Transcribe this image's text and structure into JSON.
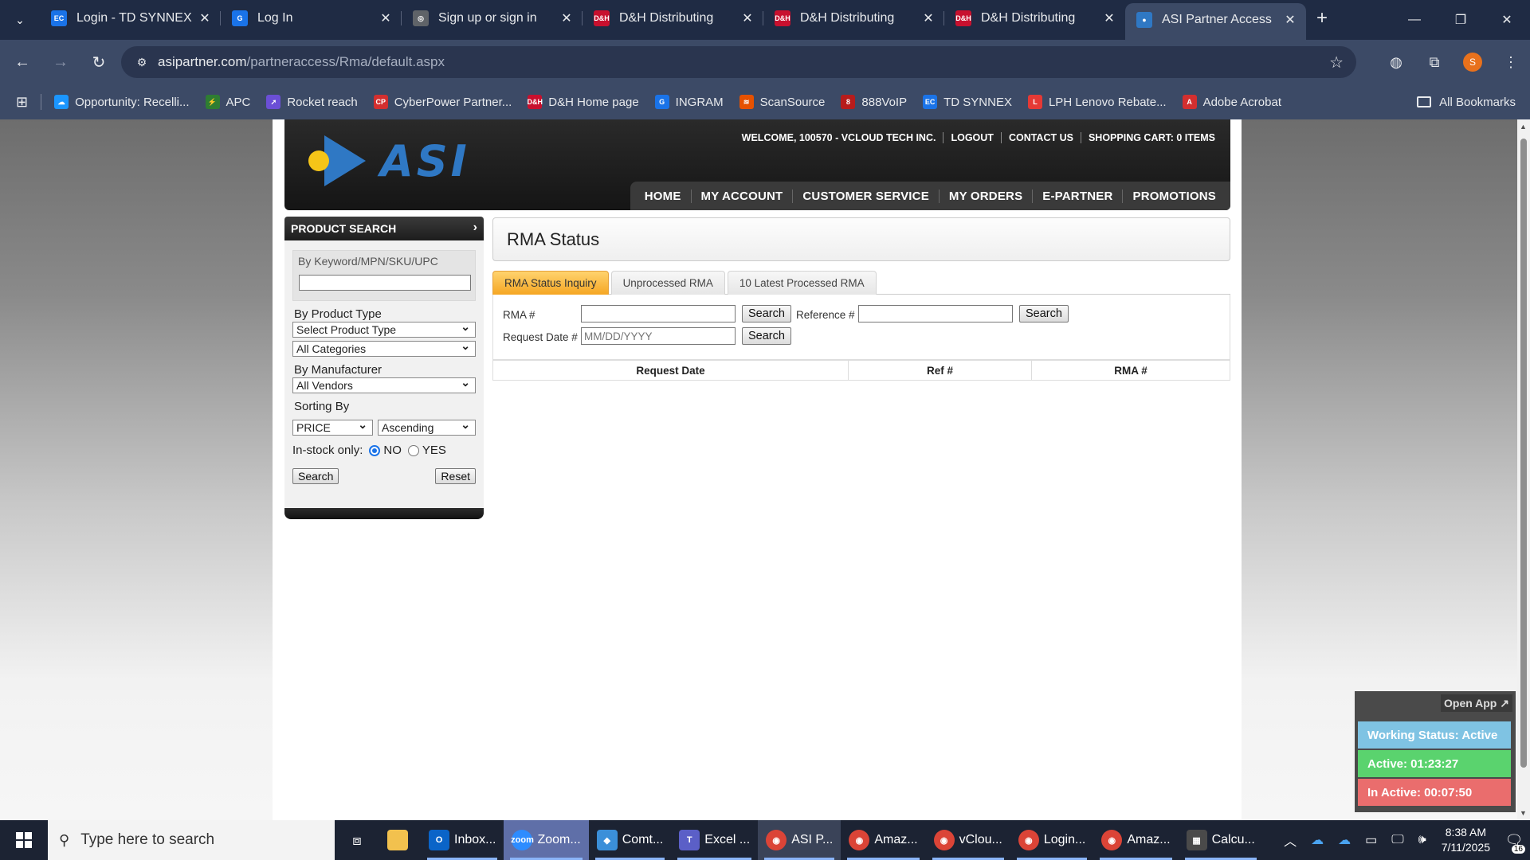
{
  "browser": {
    "tabs": [
      {
        "title": "Login - TD SYNNEX",
        "icon": "ec-icon",
        "color": "#1a73e8",
        "glyph": "EC"
      },
      {
        "title": "Log In",
        "icon": "g-logo-icon",
        "color": "#1a73e8",
        "glyph": "G"
      },
      {
        "title": "Sign up or sign in",
        "icon": "globe-icon",
        "color": "#5f6368",
        "glyph": "◎"
      },
      {
        "title": "D&H Distributing",
        "icon": "dh-icon",
        "color": "#c8102e",
        "glyph": "D&H"
      },
      {
        "title": "D&H Distributing",
        "icon": "dh-icon",
        "color": "#c8102e",
        "glyph": "D&H"
      },
      {
        "title": "D&H Distributing",
        "icon": "dh-icon",
        "color": "#c8102e",
        "glyph": "D&H"
      },
      {
        "title": "ASI Partner Access",
        "icon": "asi-icon",
        "color": "#2f78c4",
        "glyph": "●"
      }
    ],
    "active_tab": 6,
    "url_domain": "asipartner.com",
    "url_path": "/partneraccess/Rma/default.aspx",
    "profile_initial": "S",
    "bookmarks": [
      {
        "label": "Opportunity: Recelli...",
        "color": "#1b96ff",
        "glyph": "☁"
      },
      {
        "label": "APC",
        "color": "#2e7d32",
        "glyph": "⚡"
      },
      {
        "label": "Rocket reach",
        "color": "#6b4fd6",
        "glyph": "➚"
      },
      {
        "label": "CyberPower Partner...",
        "color": "#d32f2f",
        "glyph": "CP"
      },
      {
        "label": "D&H Home page",
        "color": "#c8102e",
        "glyph": "D&H"
      },
      {
        "label": "INGRAM",
        "color": "#1a73e8",
        "glyph": "G"
      },
      {
        "label": "ScanSource",
        "color": "#e65100",
        "glyph": "≋"
      },
      {
        "label": "888VoIP",
        "color": "#b71c1c",
        "glyph": "8"
      },
      {
        "label": "TD SYNNEX",
        "color": "#1a73e8",
        "glyph": "EC"
      },
      {
        "label": "LPH Lenovo Rebate...",
        "color": "#e53935",
        "glyph": "L"
      },
      {
        "label": "Adobe Acrobat",
        "color": "#d32f2f",
        "glyph": "A"
      }
    ],
    "all_bookmarks": "All Bookmarks"
  },
  "site": {
    "logo_text": "ASI",
    "top_links": [
      "WELCOME, 100570 - VCLOUD TECH INC.",
      "LOGOUT",
      "CONTACT US",
      "SHOPPING CART: 0 ITEMS"
    ],
    "nav": [
      "HOME",
      "MY ACCOUNT",
      "CUSTOMER SERVICE",
      "MY ORDERS",
      "E-PARTNER",
      "PROMOTIONS"
    ]
  },
  "sidebar": {
    "heading": "PRODUCT SEARCH",
    "keyword_label": "By Keyword/MPN/SKU/UPC",
    "product_type_label": "By Product Type",
    "product_type_value": "Select Product Type",
    "category_value": "All Categories",
    "manufacturer_label": "By Manufacturer",
    "manufacturer_value": "All Vendors",
    "sorting_label": "Sorting By",
    "sort_field": "PRICE",
    "sort_order": "Ascending",
    "instock_label": "In-stock only:",
    "instock_no": "NO",
    "instock_yes": "YES",
    "instock_selected": "NO",
    "search_button": "Search",
    "reset_button": "Reset"
  },
  "rma": {
    "title": "RMA Status",
    "tabs": [
      "RMA Status Inquiry",
      "Unprocessed RMA",
      "10 Latest Processed RMA"
    ],
    "active_tab": 0,
    "rma_label": "RMA #",
    "reference_label": "Reference #",
    "request_date_label": "Request Date #",
    "date_placeholder": "MM/DD/YYYY",
    "search_button": "Search",
    "columns": [
      "Request Date",
      "Ref #",
      "RMA #"
    ]
  },
  "widget": {
    "open_app": "Open App ↗",
    "working_status": "Working Status: Active",
    "active_time": "Active: 01:23:27",
    "inactive_time": "In Active: 00:07:50"
  },
  "taskbar": {
    "search_placeholder": "Type here to search",
    "apps": [
      {
        "label": "Inbox...",
        "icon": "outlook-icon",
        "color": "#0a64c8",
        "glyph": "O"
      },
      {
        "label": "Zoom...",
        "icon": "zoom-icon",
        "color": "#2d8cff",
        "glyph": "zoom"
      },
      {
        "label": "Comt...",
        "icon": "app-icon",
        "color": "#3b8fd9",
        "glyph": "◆"
      },
      {
        "label": "Excel ...",
        "icon": "teams-icon",
        "color": "#5b5fc7",
        "glyph": "T"
      },
      {
        "label": "ASI P...",
        "icon": "chrome-icon",
        "color": "#db4437",
        "glyph": "◉"
      },
      {
        "label": "Amaz...",
        "icon": "chrome-icon",
        "color": "#db4437",
        "glyph": "◉"
      },
      {
        "label": "vClou...",
        "icon": "chrome-icon",
        "color": "#db4437",
        "glyph": "◉"
      },
      {
        "label": "Login...",
        "icon": "chrome-icon",
        "color": "#db4437",
        "glyph": "◉"
      },
      {
        "label": "Amaz...",
        "icon": "chrome-icon",
        "color": "#db4437",
        "glyph": "◉"
      },
      {
        "label": "Calcu...",
        "icon": "calculator-icon",
        "color": "#4a4a4a",
        "glyph": "▦"
      }
    ],
    "time": "8:38 AM",
    "date": "7/11/2025",
    "notification_count": "16"
  }
}
